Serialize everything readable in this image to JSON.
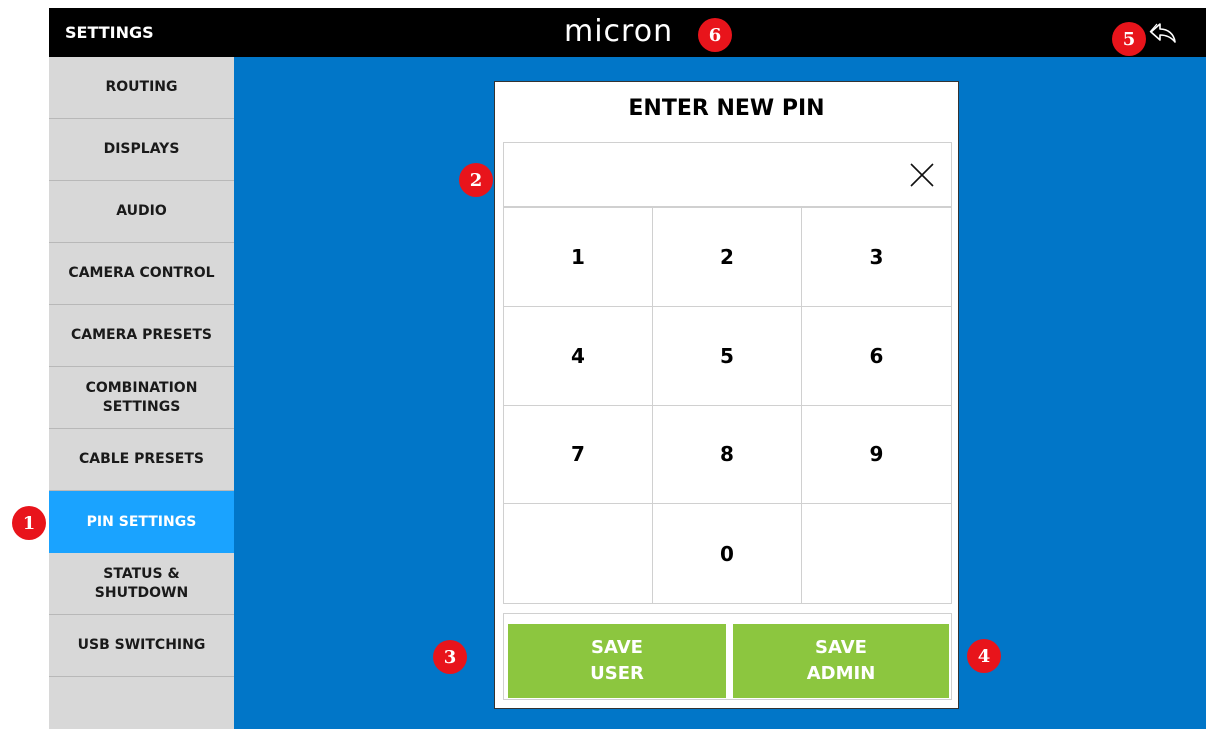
{
  "header": {
    "title": "SETTINGS",
    "logo": "micron",
    "back_icon": "back-arrow-icon"
  },
  "sidebar": {
    "items": [
      {
        "label": "ROUTING"
      },
      {
        "label": "DISPLAYS"
      },
      {
        "label": "AUDIO"
      },
      {
        "label": "CAMERA CONTROL"
      },
      {
        "label": "CAMERA PRESETS"
      },
      {
        "label": "COMBINATION\nSETTINGS"
      },
      {
        "label": "CABLE PRESETS"
      },
      {
        "label": "PIN SETTINGS",
        "active": true
      },
      {
        "label": "STATUS &\nSHUTDOWN"
      },
      {
        "label": "USB SWITCHING"
      }
    ]
  },
  "dialog": {
    "title": "ENTER NEW PIN",
    "pin_value": "",
    "clear_icon": "close-icon",
    "keys": [
      "1",
      "2",
      "3",
      "4",
      "5",
      "6",
      "7",
      "8",
      "9",
      "",
      "0",
      ""
    ],
    "save_user_label": "SAVE\nUSER",
    "save_admin_label": "SAVE\nADMIN"
  },
  "markers": [
    "1",
    "2",
    "3",
    "4",
    "5",
    "6"
  ],
  "colors": {
    "background": "#0176c8",
    "topbar": "#000000",
    "sidebar": "#d8d8d8",
    "active": "#1aa3ff",
    "save": "#8cc63f",
    "marker": "#e8141b"
  }
}
